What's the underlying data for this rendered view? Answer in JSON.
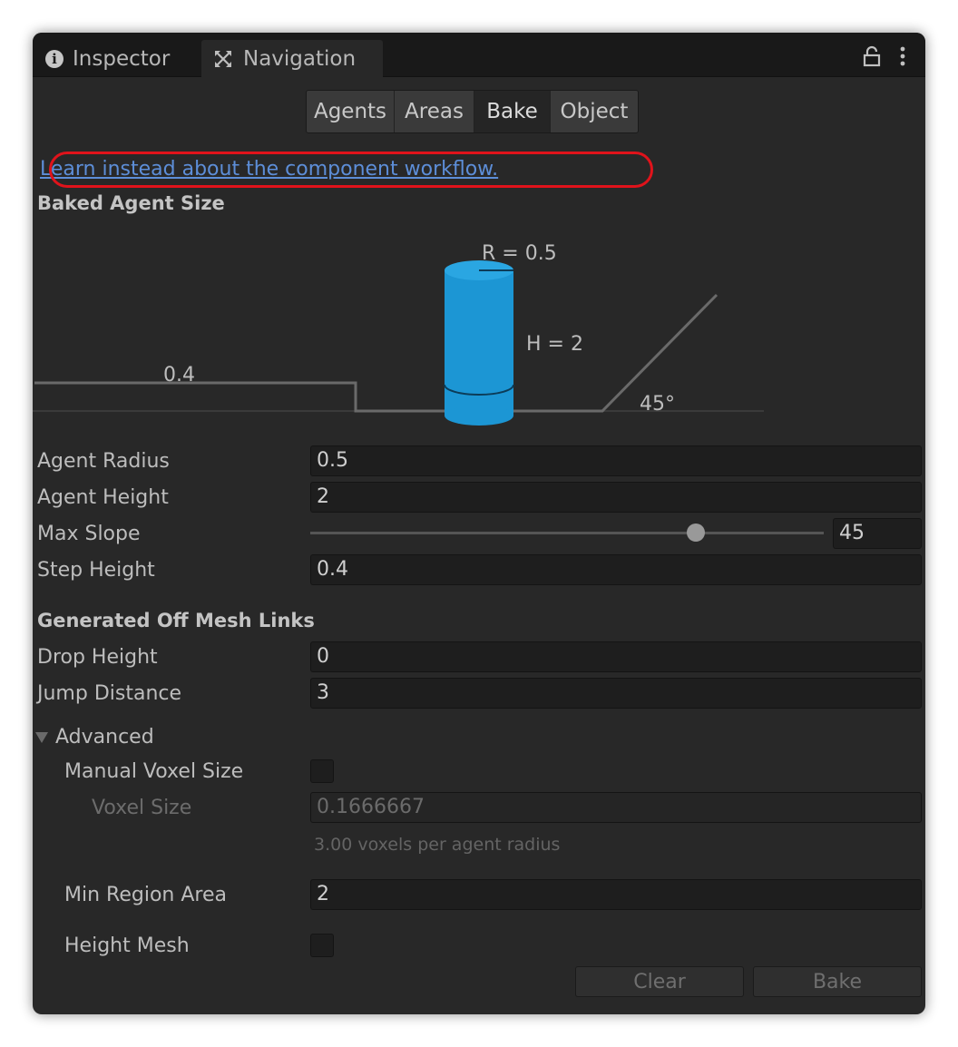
{
  "tabs": {
    "inspector": "Inspector",
    "navigation": "Navigation"
  },
  "toolbar": {
    "agents": "Agents",
    "areas": "Areas",
    "bake": "Bake",
    "object": "Object",
    "active": "Bake"
  },
  "link": "Learn instead about the component workflow.",
  "baked_agent_size": {
    "title": "Baked Agent Size",
    "diagram": {
      "radius_label": "R = 0.5",
      "height_label": "H = 2",
      "step_label": "0.4",
      "slope_label": "45°"
    }
  },
  "fields": {
    "agent_radius": {
      "label": "Agent Radius",
      "value": "0.5"
    },
    "agent_height": {
      "label": "Agent Height",
      "value": "2"
    },
    "max_slope": {
      "label": "Max Slope",
      "value": "45",
      "min": 0,
      "max": 60
    },
    "step_height": {
      "label": "Step Height",
      "value": "0.4"
    }
  },
  "off_mesh": {
    "title": "Generated Off Mesh Links",
    "drop_height": {
      "label": "Drop Height",
      "value": "0"
    },
    "jump_distance": {
      "label": "Jump Distance",
      "value": "3"
    }
  },
  "advanced": {
    "title": "Advanced",
    "manual_voxel_size": {
      "label": "Manual Voxel Size",
      "checked": false
    },
    "voxel_size": {
      "label": "Voxel Size",
      "value": "0.1666667"
    },
    "voxel_hint": "3.00 voxels per agent radius",
    "min_region_area": {
      "label": "Min Region Area",
      "value": "2"
    },
    "height_mesh": {
      "label": "Height Mesh",
      "checked": false
    }
  },
  "buttons": {
    "clear": "Clear",
    "bake": "Bake"
  },
  "colors": {
    "panel_bg": "#282828",
    "link": "#5d8ed8",
    "highlight": "#e0131b",
    "agent_cylinder": "#1c96d4"
  }
}
